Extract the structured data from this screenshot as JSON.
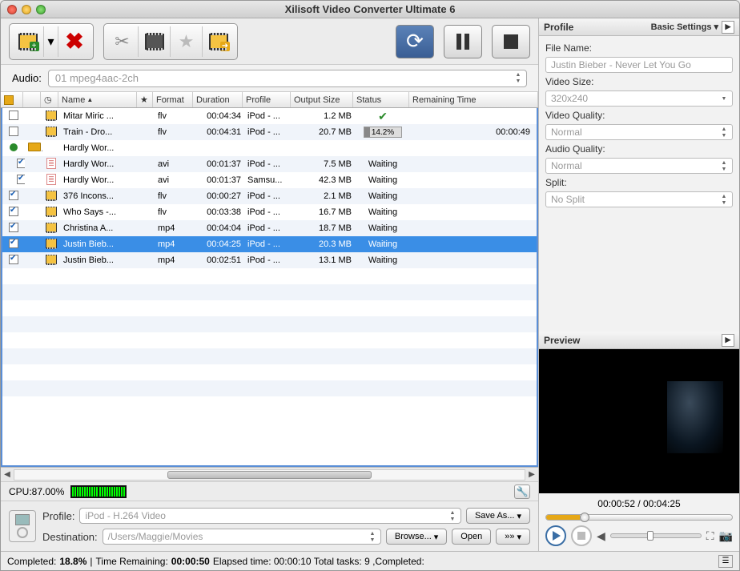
{
  "window": {
    "title": "Xilisoft Video Converter Ultimate 6"
  },
  "audio": {
    "label": "Audio:",
    "value": "01 mpeg4aac-2ch"
  },
  "columns": {
    "name": "Name",
    "format": "Format",
    "duration": "Duration",
    "profile": "Profile",
    "output_size": "Output Size",
    "status": "Status",
    "remaining": "Remaining Time"
  },
  "rows": [
    {
      "checked": false,
      "icon": "film",
      "name": "Mitar Miric ...",
      "format": "flv",
      "duration": "00:04:34",
      "profile": "iPod - ...",
      "size": "1.2 MB",
      "status": "done",
      "remaining": ""
    },
    {
      "checked": false,
      "icon": "film",
      "name": "Train - Dro...",
      "format": "flv",
      "duration": "00:04:31",
      "profile": "iPod - ...",
      "size": "20.7 MB",
      "status": "progress",
      "progress": "14.2%",
      "remaining": "00:00:49"
    },
    {
      "checked": false,
      "icon": "folder",
      "pre": "green",
      "name": "Hardly Wor...",
      "format": "",
      "duration": "",
      "profile": "",
      "size": "",
      "status": "",
      "remaining": ""
    },
    {
      "checked": true,
      "icon": "doc",
      "indent": true,
      "name": "Hardly Wor...",
      "format": "avi",
      "duration": "00:01:37",
      "profile": "iPod - ...",
      "size": "7.5 MB",
      "status": "Waiting",
      "remaining": ""
    },
    {
      "checked": true,
      "icon": "doc",
      "indent": true,
      "name": "Hardly Wor...",
      "format": "avi",
      "duration": "00:01:37",
      "profile": "Samsu...",
      "size": "42.3 MB",
      "status": "Waiting",
      "remaining": ""
    },
    {
      "checked": true,
      "icon": "film",
      "name": "376 Incons...",
      "format": "flv",
      "duration": "00:00:27",
      "profile": "iPod - ...",
      "size": "2.1 MB",
      "status": "Waiting",
      "remaining": ""
    },
    {
      "checked": true,
      "icon": "film",
      "name": "Who Says -...",
      "format": "flv",
      "duration": "00:03:38",
      "profile": "iPod - ...",
      "size": "16.7 MB",
      "status": "Waiting",
      "remaining": ""
    },
    {
      "checked": true,
      "icon": "film",
      "name": "Christina A...",
      "format": "mp4",
      "duration": "00:04:04",
      "profile": "iPod - ...",
      "size": "18.7 MB",
      "status": "Waiting",
      "remaining": ""
    },
    {
      "checked": true,
      "icon": "film",
      "name": "Justin Bieb...",
      "format": "mp4",
      "duration": "00:04:25",
      "profile": "iPod - ...",
      "size": "20.3 MB",
      "status": "Waiting",
      "remaining": "",
      "selected": true
    },
    {
      "checked": true,
      "icon": "film",
      "name": "Justin Bieb...",
      "format": "mp4",
      "duration": "00:02:51",
      "profile": "iPod - ...",
      "size": "13.1 MB",
      "status": "Waiting",
      "remaining": ""
    }
  ],
  "cpu": {
    "label": "CPU:87.00%"
  },
  "dest": {
    "profile_label": "Profile:",
    "profile_value": "iPod - H.264 Video",
    "save_as": "Save As...",
    "dest_label": "Destination:",
    "dest_value": "/Users/Maggie/Movies",
    "browse": "Browse...",
    "open": "Open"
  },
  "status": {
    "completed_lbl": "Completed:",
    "completed_val": "18.8%",
    "remaining_lbl": "Time Remaining:",
    "remaining_val": "00:00:50",
    "elapsed": "Elapsed time: 00:00:10 Total tasks: 9 ,Completed:"
  },
  "profile_panel": {
    "title": "Profile",
    "mode": "Basic Settings",
    "filename_lbl": "File Name:",
    "filename_val": "Justin Bieber - Never Let You Go",
    "videosize_lbl": "Video Size:",
    "videosize_val": "320x240",
    "videoq_lbl": "Video Quality:",
    "videoq_val": "Normal",
    "audioq_lbl": "Audio Quality:",
    "audioq_val": "Normal",
    "split_lbl": "Split:",
    "split_val": "No Split"
  },
  "preview": {
    "title": "Preview",
    "time": "00:00:52 / 00:04:25"
  }
}
